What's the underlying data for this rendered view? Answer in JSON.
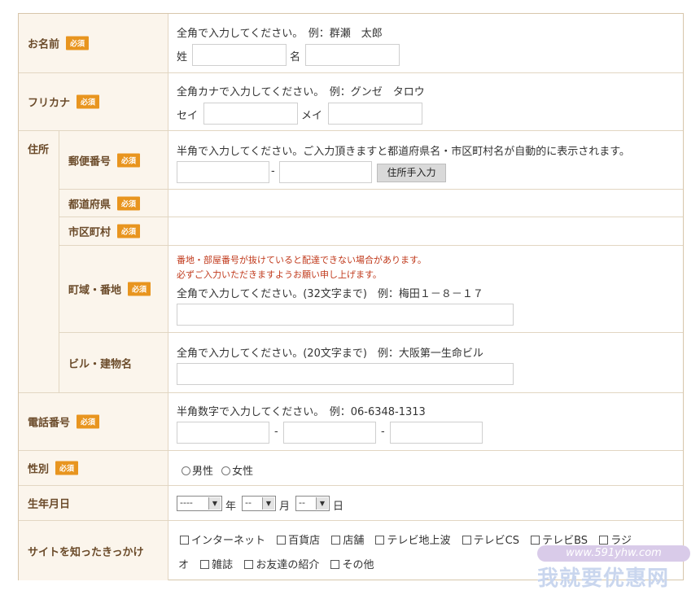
{
  "required_badge": "必須",
  "name": {
    "label": "お名前",
    "hint": "全角で入力してください。　例：群瀬　太郎",
    "last_label": "姓",
    "first_label": "名"
  },
  "kana": {
    "label": "フリカナ",
    "hint": "全角カナで入力してください。　例：グンゼ　タロウ",
    "last_label": "セイ",
    "first_label": "メイ"
  },
  "address": {
    "label": "住所",
    "postal": {
      "label": "郵便番号",
      "hint": "半角で入力してください。ご入力頂きますと都道府県名・市区町村名が自動的に表示されます。",
      "sep": "-",
      "button": "住所手入力"
    },
    "prefecture": {
      "label": "都道府県"
    },
    "city": {
      "label": "市区町村"
    },
    "street": {
      "label": "町域・番地",
      "warn1": "番地・部屋番号が抜けていると配達できない場合があります。",
      "warn2": "必ずご入力いただきますようお願い申し上げます。",
      "hint": "全角で入力してください。(32文字まで)　例：梅田１－８－１７"
    },
    "building": {
      "label": "ビル・建物名",
      "hint": "全角で入力してください。(20文字まで)　例：大阪第一生命ビル"
    }
  },
  "phone": {
    "label": "電話番号",
    "hint": "半角数字で入力してください。　例：06-6348-1313",
    "sep": "-"
  },
  "gender": {
    "label": "性別",
    "options": [
      "男性",
      "女性"
    ]
  },
  "birthday": {
    "label": "生年月日",
    "year_value": "----",
    "year_unit": "年",
    "month_value": "--",
    "month_unit": "月",
    "day_value": "--",
    "day_unit": "日"
  },
  "referral": {
    "label": "サイトを知ったきっかけ",
    "options_line1": [
      "インターネット",
      "百貨店",
      "店舗",
      "テレビ地上波",
      "テレビCS",
      "テレビBS",
      "ラジ"
    ],
    "options_line2_prefix": "オ",
    "options_line2": [
      "雑誌",
      "お友達の紹介",
      "その他"
    ]
  },
  "watermark": {
    "url": "www.591yhw.com",
    "text": "我就要优惠网"
  }
}
